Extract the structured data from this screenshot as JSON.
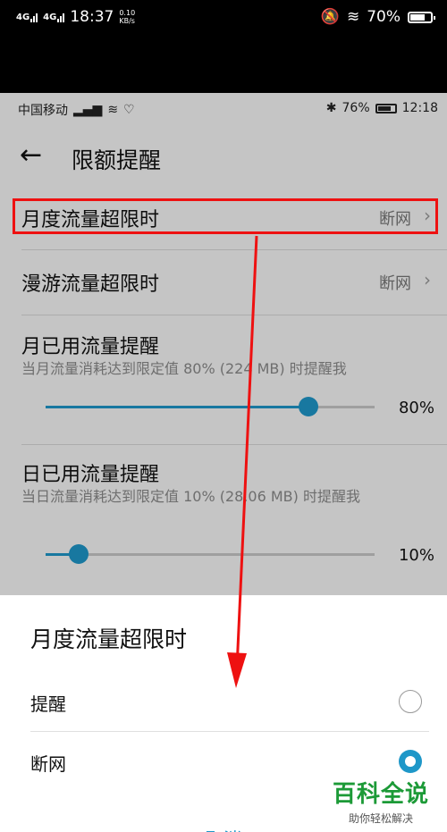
{
  "top_status": {
    "carrier1": "4G",
    "carrier2": "4G",
    "time": "18:37",
    "speed_value": "0.10",
    "speed_unit": "KB/s",
    "battery": "70%"
  },
  "inner_status": {
    "carrier": "中国移动",
    "battery": "76%",
    "time": "12:18"
  },
  "header": {
    "back_icon": "back-arrow-icon",
    "title": "限额提醒"
  },
  "settings": {
    "monthly_exceed": {
      "label": "月度流量超限时",
      "value": "断网"
    },
    "roaming_exceed": {
      "label": "漫游流量超限时",
      "value": "断网"
    },
    "monthly_used": {
      "label": "月已用流量提醒",
      "desc": "当月流量消耗达到限定值 80% (224 MB) 时提醒我",
      "percent_text": "80%",
      "level": 0.8
    },
    "daily_used": {
      "label": "日已用流量提醒",
      "desc": "当日流量消耗达到限定值 10% (28.06 MB) 时提醒我",
      "percent_text": "10%",
      "level": 0.1
    }
  },
  "sheet": {
    "title": "月度流量超限时",
    "options": [
      {
        "label": "提醒",
        "selected": false
      },
      {
        "label": "断网",
        "selected": true
      }
    ],
    "cancel": "取消"
  },
  "watermark": {
    "main": "百科全说",
    "sub": "助你轻松解决"
  },
  "colors": {
    "accent": "#1e97c8",
    "highlight": "#e11111",
    "watermark": "#1c9a37"
  }
}
